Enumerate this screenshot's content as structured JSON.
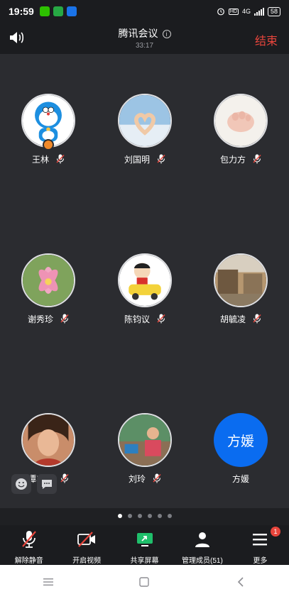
{
  "status_bar": {
    "time": "19:59",
    "network": "4G",
    "battery": "58"
  },
  "header": {
    "title": "腾讯会议",
    "timer": "33:17",
    "end_label": "结束"
  },
  "participants": [
    {
      "name": "王林"
    },
    {
      "name": "刘国明"
    },
    {
      "name": "包力方"
    },
    {
      "name": "谢秀珍"
    },
    {
      "name": "陈钧议"
    },
    {
      "name": "胡毓凌"
    },
    {
      "name": "谭丰莹"
    },
    {
      "name": "刘玲"
    },
    {
      "name": "方媛",
      "avatar_text": "方媛"
    }
  ],
  "pagination": {
    "total": 6,
    "current": 1
  },
  "toolbar": {
    "unmute": "解除静音",
    "video": "开启视频",
    "share": "共享屏幕",
    "members": "管理成员(51)",
    "more": "更多",
    "more_badge": "1"
  },
  "colors": {
    "accent_red": "#e8453c",
    "avatar_blue": "#0a6cf0",
    "share_green": "#1fbf6b"
  }
}
